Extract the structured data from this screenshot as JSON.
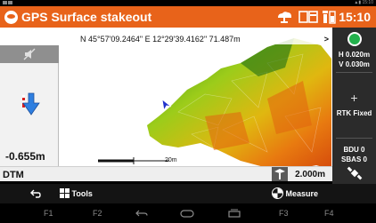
{
  "status_bar": {
    "time": "15:10"
  },
  "app_bar": {
    "title": "GPS Surface stakeout",
    "time": "15:10",
    "icons": [
      "app-logo-icon",
      "cloud-antenna-icon",
      "card-icon",
      "receiver-battery-icon"
    ]
  },
  "coordinates": {
    "text": "N 45°57'09.2464\" E 12°29'39.4162\" 71.487m"
  },
  "left_panel": {
    "icons": [
      "mute-icon",
      "cut-fill-arrow-icon"
    ],
    "vertical_distance": "-0.655m"
  },
  "right_panel": {
    "h_precision": "H 0.020m",
    "v_precision": "V 0.030m",
    "solution": "RTK Fixed",
    "bdu": "BDU 0",
    "sbas": "SBAS 0",
    "status_color": "#22b14c"
  },
  "map": {
    "scale_label": "20m"
  },
  "bottom_info": {
    "layer": "DTM",
    "height_label": "2.000m"
  },
  "action_bar": {
    "tools_label": "Tools",
    "measure_label": "Measure"
  },
  "nav_bar": {
    "f1": "F1",
    "f2": "F2",
    "f3": "F3",
    "f4": "F4"
  },
  "colors": {
    "accent": "#e8631a",
    "panel": "#2b2b2b"
  }
}
